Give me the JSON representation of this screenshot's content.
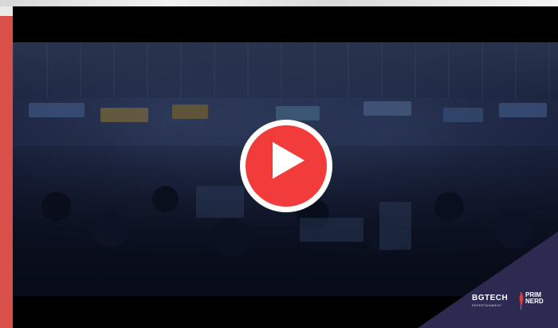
{
  "video": {
    "play_label": "Play video"
  },
  "logos": {
    "left_main": "BGTECH",
    "left_sub": "ENTERTAINMENT",
    "right_line1": "PRIM",
    "right_line2": "NERD"
  },
  "colors": {
    "accent": "#d9504a",
    "play_red": "#f23c3c",
    "corner_band": "#2d2a52"
  }
}
